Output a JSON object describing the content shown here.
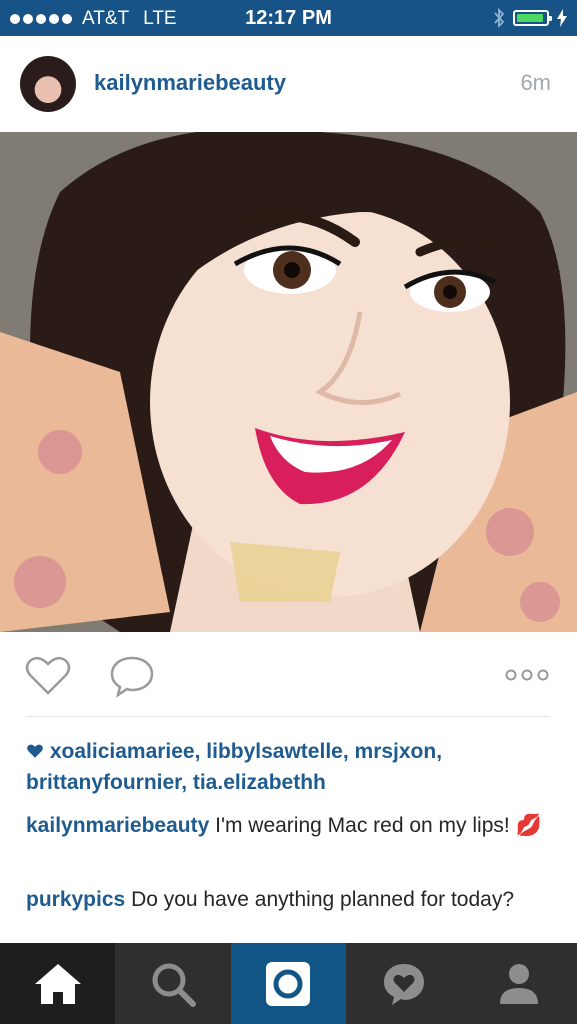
{
  "status_bar": {
    "carrier": "AT&T",
    "network": "LTE",
    "time": "12:17 PM",
    "signal_bars": 5,
    "battery_level": 0.85
  },
  "post": {
    "username": "kailynmariebeauty",
    "time_ago": "6m",
    "likes": [
      "xoaliciamariee",
      "libbylsawtelle",
      "mrsjxon",
      "brittanyfournier",
      "tia.elizabethh"
    ],
    "caption": {
      "username": "kailynmariebeauty",
      "text": "I'm wearing Mac red on my lips! 💋"
    },
    "comments": [
      {
        "username": "purkypics",
        "text": "Do you have anything planned for today?"
      }
    ]
  },
  "icons": {
    "like": "heart-icon",
    "comment": "speech-bubble-icon",
    "more": "more-options-icon",
    "likes_marker": "filled-heart-icon"
  },
  "tab_bar": [
    {
      "name": "home",
      "icon": "home-icon",
      "active": true
    },
    {
      "name": "search",
      "icon": "search-icon"
    },
    {
      "name": "camera",
      "icon": "camera-icon"
    },
    {
      "name": "activity",
      "icon": "activity-heart-icon"
    },
    {
      "name": "profile",
      "icon": "profile-icon"
    }
  ],
  "colors": {
    "status_bar": "#175386",
    "username": "#1f5b8f",
    "tab_bar": "#2f2f2f",
    "camera_tab": "#125688",
    "battery": "#4cd964"
  }
}
